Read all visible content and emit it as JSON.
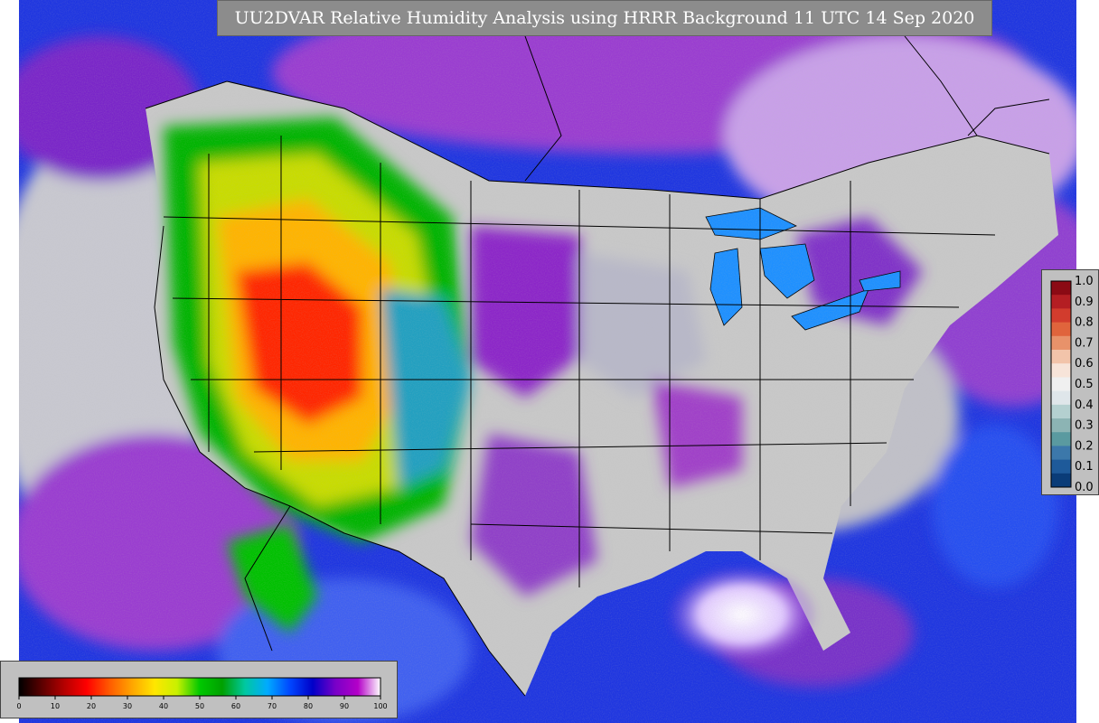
{
  "title": "UU2DVAR Relative Humidity Analysis using HRRR Background 11 UTC 14 Sep 2020",
  "humidity_colorbar": {
    "ticks": [
      "0",
      "10",
      "20",
      "30",
      "40",
      "50",
      "60",
      "70",
      "80",
      "90",
      "100"
    ],
    "colors": [
      "#000000",
      "#5a0000",
      "#b40000",
      "#ff0000",
      "#ff5a00",
      "#ffa500",
      "#ffe600",
      "#c8f000",
      "#00c800",
      "#00a000",
      "#00c8a0",
      "#00aaff",
      "#0046ff",
      "#0000c8",
      "#7800c8",
      "#b400c8",
      "#ffffff"
    ]
  },
  "obs_colorbar": {
    "ticks": [
      "1.0",
      "0.9",
      "0.8",
      "0.7",
      "0.6",
      "0.5",
      "0.4",
      "0.3",
      "0.2",
      "0.1",
      "0.0"
    ],
    "colors": [
      "#8b0a14",
      "#b41e23",
      "#d23c2d",
      "#e0643c",
      "#e8926a",
      "#f2c4aa",
      "#f7e4d9",
      "#f0f0f0",
      "#dfe6ea",
      "#b4d0d0",
      "#8cb4b4",
      "#5a9aa0",
      "#3c78aa",
      "#1e5a9a",
      "#0a3c78"
    ]
  },
  "colors": {
    "ocean": "#1e3cdc",
    "land_dry_core": "#ff1e00",
    "land_gray": "#c8c8c8",
    "border": "#000000"
  }
}
